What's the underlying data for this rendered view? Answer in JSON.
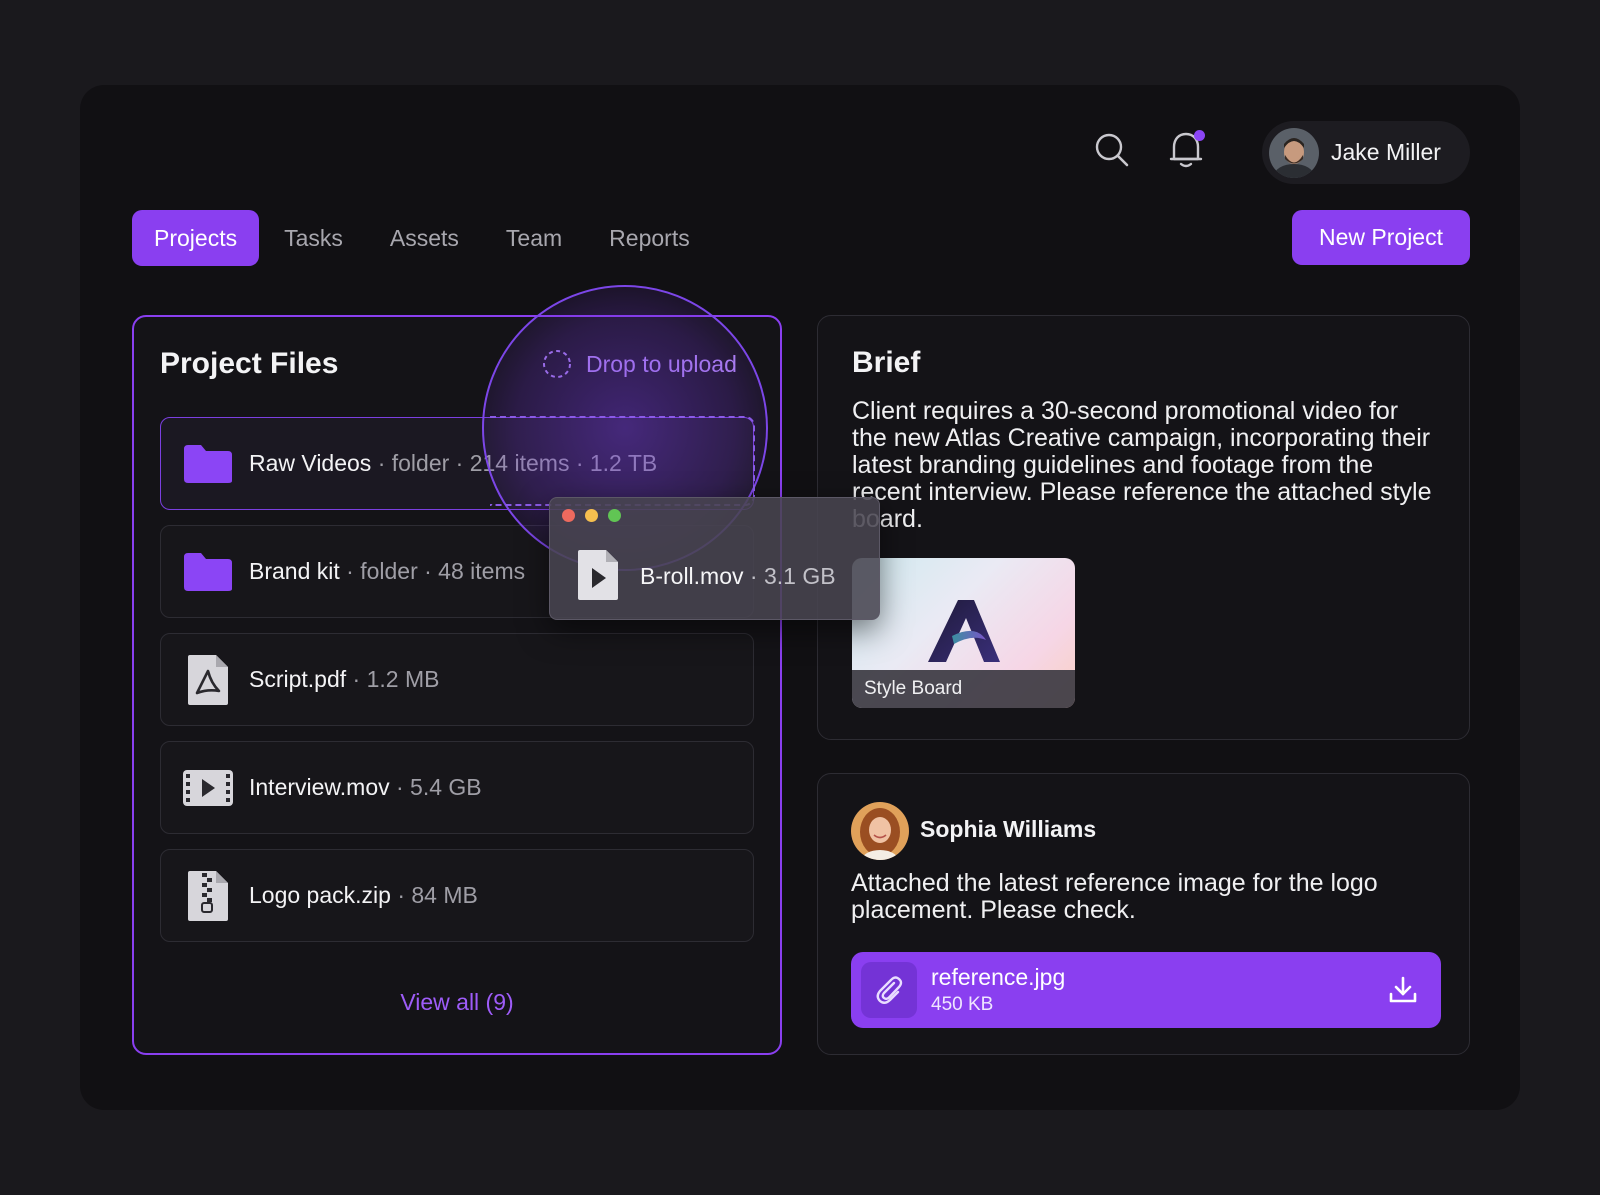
{
  "header": {
    "user": {
      "name": "Jake Miller"
    },
    "notifications": {
      "has_unread": true
    }
  },
  "tabs": [
    {
      "label": "Projects",
      "active": true
    },
    {
      "label": "Tasks",
      "active": false
    },
    {
      "label": "Assets",
      "active": false
    },
    {
      "label": "Team",
      "active": false
    },
    {
      "label": "Reports",
      "active": false
    }
  ],
  "new_project_label": "New Project",
  "project_files": {
    "title": "Project Files",
    "drop_hint": "Drop to upload",
    "files": [
      {
        "name": "Raw Videos",
        "meta": " · folder · 214 items · 1.2 TB",
        "icon": "folder-icon"
      },
      {
        "name": "Brand kit",
        "meta": " · folder · 48 items",
        "icon": "folder-icon"
      },
      {
        "name": "Script.pdf",
        "meta": " · 1.2 MB",
        "icon": "pdf-file-icon"
      },
      {
        "name": "Interview.mov",
        "meta": " · 5.4 GB",
        "icon": "video-file-icon"
      },
      {
        "name": "Logo pack.zip",
        "meta": " · 84 MB",
        "icon": "zip-file-icon"
      }
    ],
    "view_all": "View all (9)",
    "dragging_file": {
      "name": "B-roll.mov",
      "meta": " · 3.1 GB",
      "icon": "play-file-icon"
    }
  },
  "brief": {
    "title": "Brief",
    "text": "Client requires a 30-second promotional video for the new Atlas Creative campaign, incorporating their latest branding guidelines and footage from the recent interview. Please reference the attached style board.",
    "attachment_label": "Style Board"
  },
  "comment": {
    "author": "Sophia Williams",
    "text": "Attached the latest reference image for the logo placement. Please check.",
    "attachment": {
      "name": "reference.jpg",
      "size": "450 KB"
    }
  },
  "colors": {
    "accent": "#8a3ff0",
    "background": "#111013",
    "card_border": "#2d2c33",
    "link": "#9e5cf8"
  }
}
